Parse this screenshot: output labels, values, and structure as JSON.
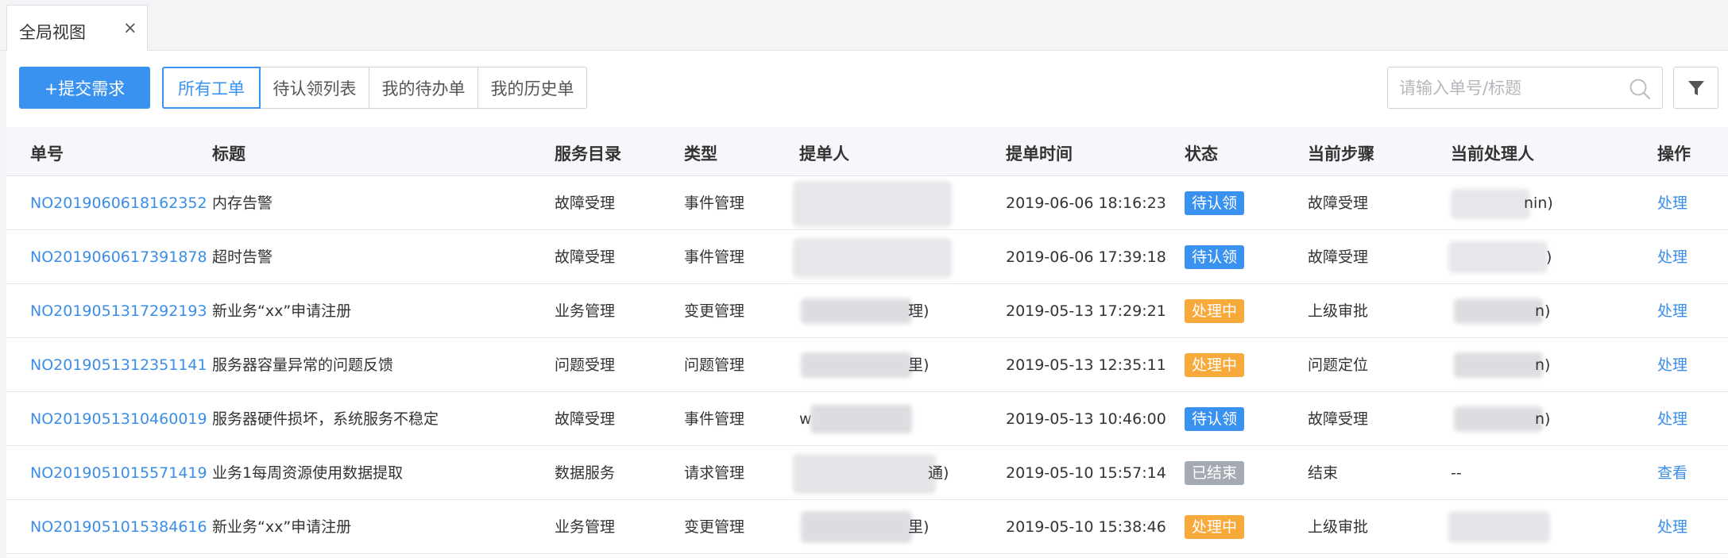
{
  "tab": {
    "label": "全局视图",
    "close": "×"
  },
  "toolbar": {
    "submit_label": "+提交需求",
    "segments": [
      "所有工单",
      "待认领列表",
      "我的待办单",
      "我的历史单"
    ],
    "search_placeholder": "请输入单号/标题"
  },
  "columns": [
    "单号",
    "标题",
    "服务目录",
    "类型",
    "提单人",
    "提单时间",
    "状态",
    "当前步骤",
    "当前处理人",
    "操作"
  ],
  "rows": [
    {
      "id": "NO2019060618162352",
      "title": "内存告警",
      "catalog": "故障受理",
      "type": "事件管理",
      "submitter": "",
      "time": "2019-06-06 18:16:23",
      "status": "待认领",
      "status_kind": "pending",
      "step": "故障受理",
      "handler": "nin)",
      "op": "处理"
    },
    {
      "id": "NO2019060617391878",
      "title": "超时告警",
      "catalog": "故障受理",
      "type": "事件管理",
      "submitter": "",
      "time": "2019-06-06 17:39:18",
      "status": "待认领",
      "status_kind": "pending",
      "step": "故障受理",
      "handler": ")",
      "op": "处理"
    },
    {
      "id": "NO2019051317292193",
      "title": "新业务“xx”申请注册",
      "catalog": "业务管理",
      "type": "变更管理",
      "submitter": "理)",
      "time": "2019-05-13 17:29:21",
      "status": "处理中",
      "status_kind": "processing",
      "step": "上级审批",
      "handler": "n)",
      "op": "处理"
    },
    {
      "id": "NO2019051312351141",
      "title": "服务器容量异常的问题反馈",
      "catalog": "问题受理",
      "type": "问题管理",
      "submitter": "里)",
      "time": "2019-05-13 12:35:11",
      "status": "处理中",
      "status_kind": "processing",
      "step": "问题定位",
      "handler": "n)",
      "op": "处理"
    },
    {
      "id": "NO2019051310460019",
      "title": "服务器硬件损坏，系统服务不稳定",
      "catalog": "故障受理",
      "type": "事件管理",
      "submitter": "w 里)",
      "time": "2019-05-13 10:46:00",
      "status": "待认领",
      "status_kind": "pending",
      "step": "故障受理",
      "handler": "n)",
      "op": "处理"
    },
    {
      "id": "NO2019051015571419",
      "title": "业务1每周资源使用数据提取",
      "catalog": "数据服务",
      "type": "请求管理",
      "submitter": "通)",
      "time": "2019-05-10 15:57:14",
      "status": "已结束",
      "status_kind": "done",
      "step": "结束",
      "handler": "--",
      "op": "查看"
    },
    {
      "id": "NO2019051015384616",
      "title": "新业务“xx”申请注册",
      "catalog": "业务管理",
      "type": "变更管理",
      "submitter": "里)",
      "time": "2019-05-10 15:38:46",
      "status": "处理中",
      "status_kind": "processing",
      "step": "上级审批",
      "handler": "",
      "op": "处理"
    }
  ],
  "colors": {
    "accent": "#3a92f0",
    "pending": "#3a92f0",
    "processing": "#f7a93a",
    "done": "#a4aab2",
    "link": "#3a8ee6"
  },
  "icons": {
    "close": "close-icon",
    "search": "search-icon",
    "filter": "filter-icon"
  }
}
